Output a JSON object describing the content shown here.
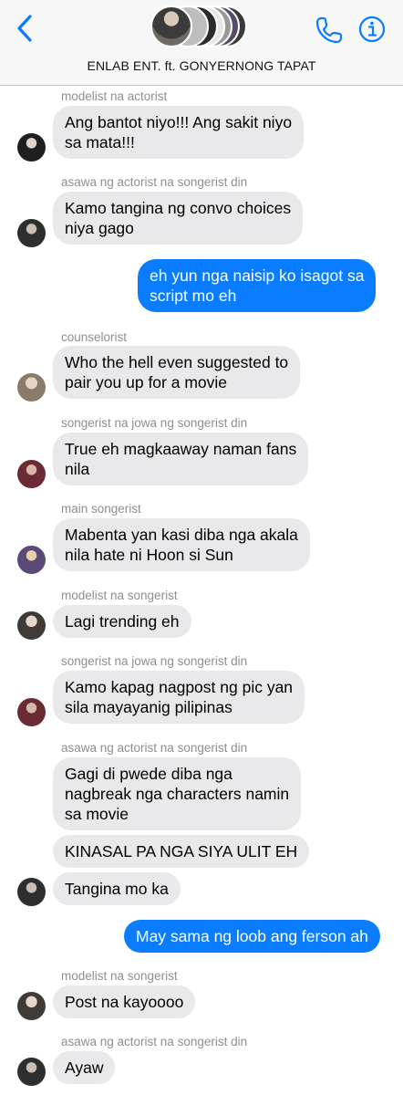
{
  "header": {
    "title": "ENLAB ENT. ft. GONYERNONG TAPAT",
    "back_icon": "chevron-left-icon",
    "call_icon": "phone-icon",
    "info_icon": "info-icon"
  },
  "colors": {
    "accent": "#0a7cff",
    "incoming_bubble": "#e9e9eb",
    "sender_label": "#8e8e93"
  },
  "messages": [
    {
      "sender": "modelist na actorist",
      "lines": [
        "Ang bantot niyo!!! Ang sakit niyo",
        "sa mata!!!"
      ]
    },
    {
      "sender": "asawa ng actorist na songerist din",
      "lines": [
        "Kamo tangina ng convo choices",
        "niya gago"
      ]
    },
    {
      "lines": [
        "eh yun nga naisip ko isagot sa",
        "script mo eh"
      ]
    },
    {
      "sender": "counselorist",
      "lines": [
        "Who the hell even suggested to",
        "pair you up for a movie"
      ]
    },
    {
      "sender": "songerist na jowa ng songerist din",
      "lines": [
        "True eh magkaaway naman fans",
        "nila"
      ]
    },
    {
      "sender": "main songerist",
      "lines": [
        "Mabenta yan kasi diba nga akala",
        "nila hate ni Hoon si Sun"
      ]
    },
    {
      "sender": "modelist na songerist",
      "lines": [
        "Lagi trending eh"
      ]
    },
    {
      "sender": "songerist na jowa ng songerist din",
      "lines": [
        "Kamo kapag nagpost ng pic yan",
        "sila mayayanig pilipinas"
      ]
    },
    {
      "sender": "asawa ng actorist na songerist din",
      "lines": [
        "Gagi di pwede diba nga",
        "nagbreak nga characters namin",
        "sa movie"
      ]
    },
    {
      "lines": [
        "KINASAL PA NGA SIYA ULIT EH"
      ]
    },
    {
      "lines": [
        "Tangina mo ka"
      ]
    },
    {
      "lines": [
        "May sama ng loob ang ferson ah"
      ]
    },
    {
      "sender": "modelist na songerist",
      "lines": [
        "Post na kayoooo"
      ]
    },
    {
      "sender": "asawa ng actorist na songerist din",
      "lines": [
        "Ayaw"
      ]
    }
  ]
}
